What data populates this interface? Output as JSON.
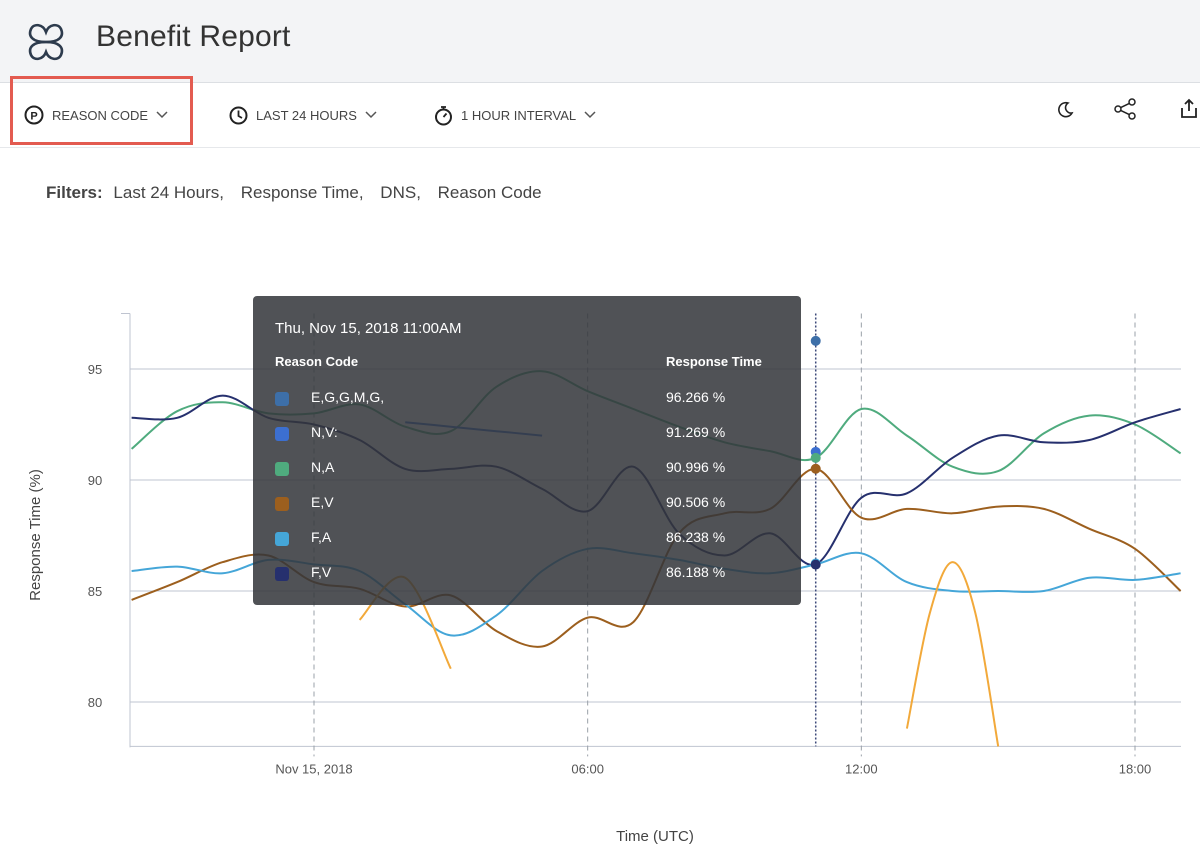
{
  "header": {
    "title": "Benefit Report"
  },
  "toolbar": {
    "reason_code_label": "REASON CODE",
    "time_range_label": "LAST 24 HOURS",
    "interval_label": "1 HOUR INTERVAL",
    "icons": [
      "p-circle-icon",
      "clock-icon",
      "stopwatch-icon",
      "moon-icon",
      "share-icon",
      "export-icon"
    ],
    "highlight_color": "#e35b50"
  },
  "filters": {
    "label": "Filters:",
    "values": [
      "Last 24 Hours,",
      "Response Time,",
      "DNS,",
      "Reason Code"
    ]
  },
  "tooltip": {
    "date": "Thu, Nov 15, 2018 11:00AM",
    "col_code": "Reason Code",
    "col_value": "Response Time",
    "rows": [
      {
        "code": "E,G,G,M,G,",
        "value": "96.266 %",
        "color": "#3d6fa8"
      },
      {
        "code": "N,V:",
        "value": "91.269 %",
        "color": "#3c6fd0"
      },
      {
        "code": "N,A",
        "value": "90.996 %",
        "color": "#4fab7e"
      },
      {
        "code": "E,V",
        "value": "90.506 %",
        "color": "#9c5f1e"
      },
      {
        "code": "F,A",
        "value": "86.238 %",
        "color": "#45a6d8"
      },
      {
        "code": "F,V",
        "value": "86.188 %",
        "color": "#26306e"
      }
    ]
  },
  "chart_data": {
    "type": "line",
    "xlabel": "Time (UTC)",
    "ylabel": "Response Time (%)",
    "ylim": [
      78,
      98
    ],
    "yticks": [
      80,
      85,
      90,
      95
    ],
    "xlim": [
      -4,
      19.5
    ],
    "xticks": [
      {
        "x": 0,
        "label": "Nov 15, 2018"
      },
      {
        "x": 6,
        "label": "06:00"
      },
      {
        "x": 12,
        "label": "12:00"
      },
      {
        "x": 18,
        "label": "18:00"
      }
    ],
    "grid": true,
    "crosshair_x": 11,
    "series": [
      {
        "color": "#4fab7e",
        "points": [
          [
            -4,
            91.4
          ],
          [
            -3,
            93.1
          ],
          [
            -2,
            93.5
          ],
          [
            -1,
            93.0
          ],
          [
            0,
            93.0
          ],
          [
            1,
            93.4
          ],
          [
            2,
            92.4
          ],
          [
            3,
            92.2
          ],
          [
            4,
            94.2
          ],
          [
            5,
            94.9
          ],
          [
            6,
            94.0
          ],
          [
            7,
            93.2
          ],
          [
            8,
            92.4
          ],
          [
            9,
            91.7
          ],
          [
            10,
            91.3
          ],
          [
            11,
            91.0
          ],
          [
            12,
            93.2
          ],
          [
            13,
            92.0
          ],
          [
            14,
            90.6
          ],
          [
            15,
            90.4
          ],
          [
            16,
            92.1
          ],
          [
            17,
            92.9
          ],
          [
            18,
            92.5
          ],
          [
            19,
            91.2
          ]
        ]
      },
      {
        "color": "#26306e",
        "points": [
          [
            -4,
            92.8
          ],
          [
            -3,
            92.8
          ],
          [
            -2,
            93.8
          ],
          [
            -1,
            92.8
          ],
          [
            0,
            92.5
          ],
          [
            1,
            91.8
          ],
          [
            2,
            90.5
          ],
          [
            3,
            90.5
          ],
          [
            4,
            90.6
          ],
          [
            5,
            89.6
          ],
          [
            6,
            88.6
          ],
          [
            7,
            90.6
          ],
          [
            8,
            87.6
          ],
          [
            9,
            86.6
          ],
          [
            10,
            87.6
          ],
          [
            11,
            86.2
          ],
          [
            12,
            89.2
          ],
          [
            13,
            89.4
          ],
          [
            14,
            91.0
          ],
          [
            15,
            92.0
          ],
          [
            16,
            91.7
          ],
          [
            17,
            91.8
          ],
          [
            18,
            92.6
          ],
          [
            19,
            93.2
          ]
        ]
      },
      {
        "color": "#9c5f1e",
        "points": [
          [
            -4,
            84.6
          ],
          [
            -3,
            85.4
          ],
          [
            -2,
            86.3
          ],
          [
            -1,
            86.6
          ],
          [
            0,
            85.4
          ],
          [
            1,
            85.1
          ],
          [
            2,
            84.3
          ],
          [
            3,
            84.8
          ],
          [
            4,
            83.2
          ],
          [
            5,
            82.5
          ],
          [
            6,
            83.8
          ],
          [
            7,
            83.6
          ],
          [
            8,
            87.6
          ],
          [
            9,
            88.5
          ],
          [
            10,
            88.7
          ],
          [
            11,
            90.5
          ],
          [
            12,
            88.3
          ],
          [
            13,
            88.7
          ],
          [
            14,
            88.5
          ],
          [
            15,
            88.8
          ],
          [
            16,
            88.7
          ],
          [
            17,
            87.8
          ],
          [
            18,
            86.9
          ],
          [
            19,
            85.0
          ]
        ]
      },
      {
        "color": "#45a6d8",
        "points": [
          [
            -4,
            85.9
          ],
          [
            -3,
            86.1
          ],
          [
            -2,
            85.8
          ],
          [
            -1,
            86.4
          ],
          [
            0,
            86.2
          ],
          [
            1,
            85.9
          ],
          [
            2,
            84.4
          ],
          [
            3,
            83.0
          ],
          [
            4,
            83.9
          ],
          [
            5,
            85.9
          ],
          [
            6,
            86.9
          ],
          [
            7,
            86.7
          ],
          [
            8,
            86.4
          ],
          [
            9,
            86.0
          ],
          [
            10,
            85.8
          ],
          [
            11,
            86.2
          ],
          [
            12,
            86.7
          ],
          [
            13,
            85.4
          ],
          [
            14,
            85.0
          ],
          [
            15,
            85.0
          ],
          [
            16,
            85.0
          ],
          [
            17,
            85.6
          ],
          [
            18,
            85.5
          ],
          [
            19,
            85.8
          ]
        ]
      },
      {
        "color": "#f2a93a",
        "points": [
          [
            1,
            83.7
          ],
          [
            2,
            85.6
          ],
          [
            3,
            81.5
          ]
        ]
      },
      {
        "color": "#f2a93a",
        "points": [
          [
            13,
            78.8
          ],
          [
            13.5,
            84.0
          ],
          [
            14,
            86.3
          ],
          [
            14.5,
            84.0
          ],
          [
            15,
            78.0
          ]
        ]
      },
      {
        "color": "#3c6fd0",
        "points": [
          [
            2,
            92.6
          ],
          [
            3,
            92.4
          ],
          [
            4,
            92.2
          ],
          [
            5,
            92.0
          ]
        ]
      }
    ],
    "markers": [
      {
        "x": 11,
        "y": 96.266,
        "color": "#3d6fa8"
      },
      {
        "x": 11,
        "y": 91.269,
        "color": "#3c6fd0"
      },
      {
        "x": 11,
        "y": 90.996,
        "color": "#4fab7e"
      },
      {
        "x": 11,
        "y": 90.506,
        "color": "#9c5f1e"
      },
      {
        "x": 11,
        "y": 86.238,
        "color": "#45a6d8"
      },
      {
        "x": 11,
        "y": 86.188,
        "color": "#26306e"
      }
    ]
  }
}
